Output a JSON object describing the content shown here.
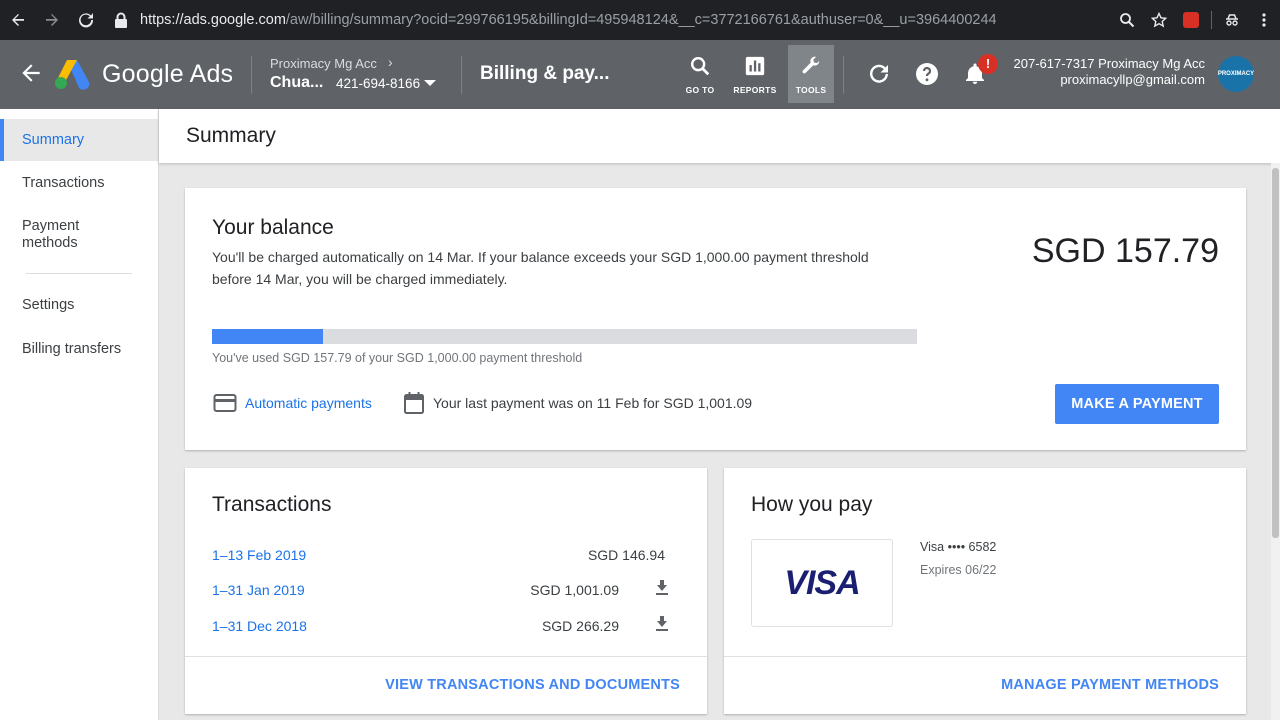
{
  "browser": {
    "url_host": "https://ads.google.com",
    "url_rest": "/aw/billing/summary?ocid=299766195&billingId=495948124&__c=3772166761&authuser=0&__u=3964400244",
    "icons": [
      "back-icon",
      "forward-icon",
      "reload-icon",
      "zoom-icon",
      "star-icon",
      "extension-icon",
      "incognito-icon",
      "menu-icon"
    ]
  },
  "header": {
    "logo_text": "Google Ads",
    "account_parent": "Proximacy Mg Acc",
    "account_name": "Chua...",
    "account_id": "421-694-8166",
    "page_title": "Billing & pay...",
    "tools": [
      {
        "label": "GO TO"
      },
      {
        "label": "REPORTS"
      },
      {
        "label": "TOOLS"
      }
    ],
    "notification_badge": "!",
    "user_line1": "207-617-7317 Proximacy Mg Acc",
    "user_line2": "proximacyllp@gmail.com",
    "avatar_text": "PROXIMACY"
  },
  "sidebar": {
    "items": [
      {
        "label": "Summary",
        "active": true
      },
      {
        "label": "Transactions"
      },
      {
        "label": "Payment methods"
      },
      {
        "label": "Settings"
      },
      {
        "label": "Billing transfers"
      }
    ]
  },
  "main": {
    "title": "Summary",
    "balance": {
      "title": "Your balance",
      "description": "You'll be charged automatically on 14 Mar. If your balance exceeds your SGD 1,000.00 payment threshold before 14 Mar, you will be charged immediately.",
      "amount": "SGD 157.79",
      "progress_fraction": 0.158,
      "progress_note": "You've used SGD 157.79 of your SGD 1,000.00 payment threshold",
      "auto_payments_label": "Automatic payments",
      "last_payment": "Your last payment was on 11 Feb for SGD 1,001.09",
      "make_payment_label": "MAKE A PAYMENT"
    },
    "transactions": {
      "title": "Transactions",
      "rows": [
        {
          "period": "1–13 Feb 2019",
          "amount": "SGD 146.94",
          "download": false
        },
        {
          "period": "1–31 Jan 2019",
          "amount": "SGD 1,001.09",
          "download": true
        },
        {
          "period": "1–31 Dec 2018",
          "amount": "SGD 266.29",
          "download": true
        }
      ],
      "footer_link": "VIEW TRANSACTIONS AND DOCUMENTS"
    },
    "how_you_pay": {
      "title": "How you pay",
      "card_brand": "VISA",
      "card_number": "Visa •••• 6582",
      "expires": "Expires 06/22",
      "footer_link": "MANAGE PAYMENT METHODS"
    }
  },
  "colors": {
    "accent": "#4285f4",
    "link": "#1a73e8",
    "header_bg": "#5f6368",
    "badge": "#d93025"
  }
}
